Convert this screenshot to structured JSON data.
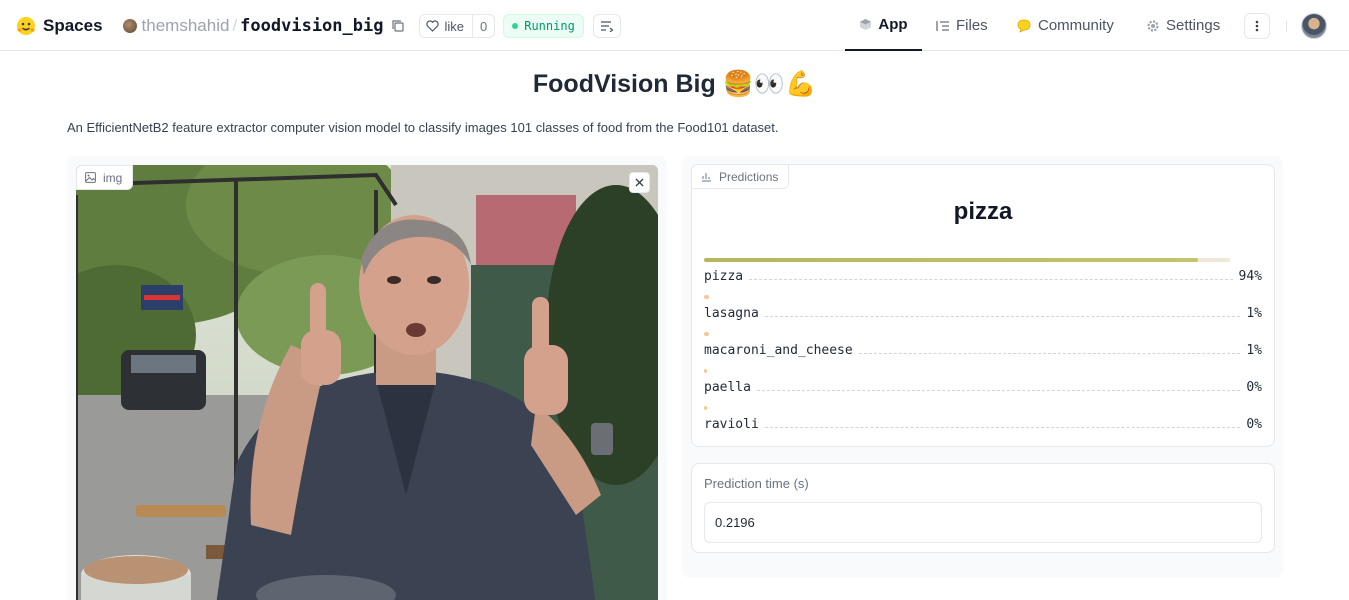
{
  "header": {
    "spaces_label": "Spaces",
    "owner": "themshahid",
    "separator": "/",
    "repo": "foodvision_big",
    "like_label": "like",
    "like_count": "0",
    "status": "Running",
    "tabs": [
      {
        "label": "App",
        "icon": "cube-icon",
        "active": true
      },
      {
        "label": "Files",
        "icon": "files-icon",
        "active": false
      },
      {
        "label": "Community",
        "icon": "community-icon",
        "active": false
      },
      {
        "label": "Settings",
        "icon": "gear-icon",
        "active": false
      }
    ]
  },
  "app": {
    "title": "FoodVision Big",
    "title_emoji": "🍔👀💪",
    "description": "An EfficientNetB2 feature extractor computer vision model to classify images 101 classes of food from the Food101 dataset.",
    "image_input": {
      "label": "img"
    },
    "predictions": {
      "label": "Predictions",
      "top": "pizza",
      "items": [
        {
          "name": "pizza",
          "pct": "94%",
          "value": 0.94
        },
        {
          "name": "lasagna",
          "pct": "1%",
          "value": 0.01
        },
        {
          "name": "macaroni_and_cheese",
          "pct": "1%",
          "value": 0.01
        },
        {
          "name": "paella",
          "pct": "0%",
          "value": 0.004
        },
        {
          "name": "ravioli",
          "pct": "0%",
          "value": 0.002
        }
      ]
    },
    "prediction_time": {
      "label": "Prediction time (s)",
      "value": "0.2196"
    }
  },
  "colors": {
    "bar": "#b5b85a",
    "running": "#059669",
    "accent": "#111827"
  }
}
